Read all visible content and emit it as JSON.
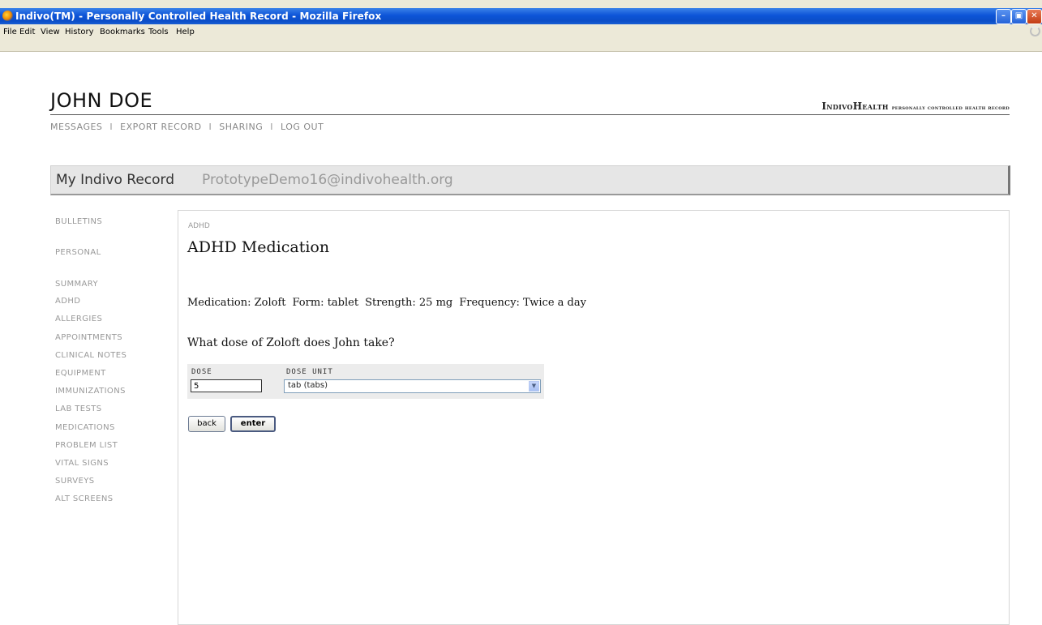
{
  "window": {
    "title": "Indivo(TM) - Personally Controlled Health Record - Mozilla Firefox",
    "icon": "firefox-icon"
  },
  "menu": [
    "File",
    "Edit",
    "View",
    "History",
    "Bookmarks",
    "Tools",
    "Help"
  ],
  "header": {
    "patient_name": "JOHN DOE",
    "brand_main": "IndivoHealth",
    "brand_sub": "personally controlled health record",
    "nav": [
      "MESSAGES",
      "EXPORT RECORD",
      "SHARING",
      "LOG OUT"
    ],
    "nav_separator": "I"
  },
  "record_bar": {
    "label": "My Indivo Record",
    "email": "PrototypeDemo16@indivohealth.org"
  },
  "sidebar": {
    "items": [
      "BULLETINS",
      "PERSONAL",
      "SUMMARY",
      "ADHD",
      "ALLERGIES",
      "APPOINTMENTS",
      "CLINICAL NOTES",
      "EQUIPMENT",
      "IMMUNIZATIONS",
      "LAB TESTS",
      "MEDICATIONS",
      "PROBLEM LIST",
      "VITAL SIGNS",
      "SURVEYS",
      "ALT SCREENS"
    ]
  },
  "main": {
    "breadcrumb": "ADHD",
    "title": "ADHD Medication",
    "medication": {
      "medication": "Medication: Zoloft",
      "form": "Form: tablet",
      "strength": "Strength: 25 mg",
      "frequency": "Frequency: Twice a day"
    },
    "question": "What dose of Zoloft does John take?",
    "form": {
      "dose_label": "DOSE",
      "dose_value": "5",
      "unit_label": "DOSE UNIT",
      "unit_value": "tab (tabs)"
    },
    "buttons": {
      "back": "back",
      "enter": "enter"
    }
  },
  "colors": {
    "titlebar": "#0d55d8",
    "chrome": "#ece9d8",
    "muted_text": "#999999",
    "record_bar_bg": "#e6e6e6"
  }
}
